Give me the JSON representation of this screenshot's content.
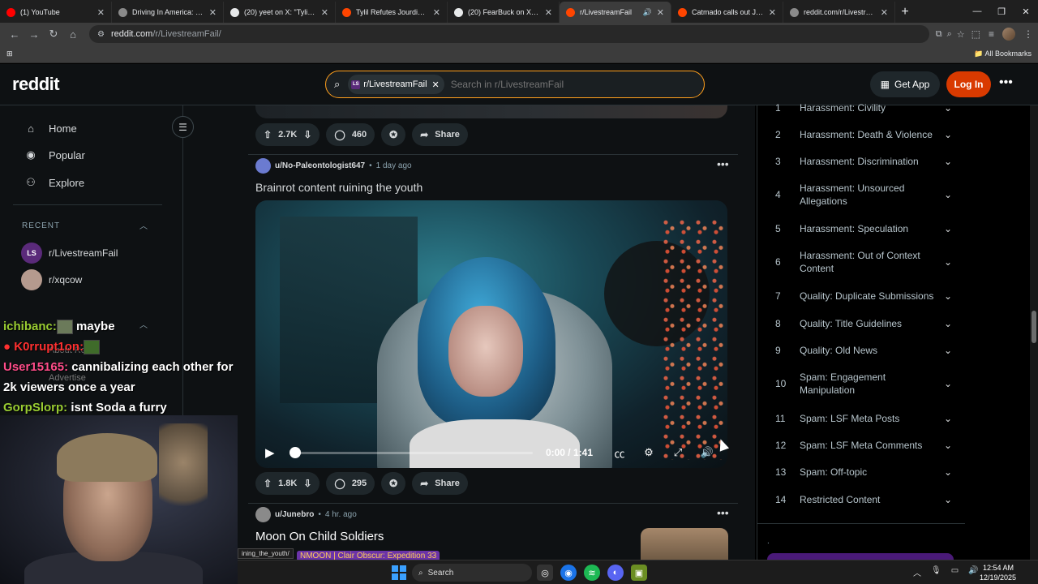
{
  "browser": {
    "tabs": [
      {
        "title": "(1) YouTube",
        "color": "#ff0000",
        "active": false
      },
      {
        "title": "Driving In America: Comm",
        "color": "#8a8a8a",
        "active": false
      },
      {
        "title": "(20) yeet on X: \"Tylil denie",
        "color": "#e7e9ea",
        "active": false
      },
      {
        "title": "Tylil Refutes Jourdin Pauli",
        "color": "#ff4500",
        "active": false
      },
      {
        "title": "(20) FearBuck on X: \"Tylil a",
        "color": "#e7e9ea",
        "active": false
      },
      {
        "title": "r/LivestreamFail",
        "color": "#ff4500",
        "active": true
      },
      {
        "title": "Catmado calls out JasonT",
        "color": "#ff4500",
        "active": false
      },
      {
        "title": "reddit.com/r/Livestreamf",
        "color": "#8a8a8a",
        "active": false
      }
    ],
    "url_host": "reddit.com",
    "url_path": "/r/LivestreamFail/",
    "bookmarks_label": "All Bookmarks"
  },
  "header": {
    "logo": "reddit",
    "search_chip": "r/LivestreamFail",
    "search_chip_badge": "LS",
    "search_placeholder": "Search in r/LivestreamFail",
    "get_app": "Get App",
    "login": "Log In"
  },
  "sidebar": {
    "items": [
      {
        "label": "Home",
        "icon": "home-icon"
      },
      {
        "label": "Popular",
        "icon": "popular-icon"
      },
      {
        "label": "Explore",
        "icon": "explore-icon"
      }
    ],
    "recent_heading": "RECENT",
    "recent": [
      {
        "label": "r/LivestreamFail",
        "badge": "LS"
      },
      {
        "label": "r/xqcow",
        "badge": ""
      }
    ],
    "ghost_about": "About Redd",
    "ghost_advertise": "Advertise"
  },
  "chat": [
    {
      "user": "ichibanc:",
      "text": "maybe"
    },
    {
      "user": "K0rrupt1on:",
      "text": ""
    },
    {
      "user": "User15165:",
      "text": "cannibalizing each other for 2k viewers once a year"
    },
    {
      "user": "GorpSlorp:",
      "text": "isnt Soda a furry"
    }
  ],
  "tooltip": "ining_the_youth/",
  "feed": {
    "prev_post": {
      "votes": "2.7K",
      "comments": "460",
      "share": "Share"
    },
    "post1": {
      "author": "u/No-Paleontologist647",
      "time": "1 day ago",
      "title": "Brainrot content ruining the youth",
      "video_time": "0:00 / 1:41",
      "progress": 0,
      "votes": "1.8K",
      "comments": "295",
      "share": "Share"
    },
    "post2": {
      "author": "u/Junebro",
      "time": "4 hr. ago",
      "title": "Moon On Child Soldiers",
      "flair": "NMOON | Clair Obscur: Expedition 33"
    }
  },
  "rules": [
    {
      "num": "1",
      "text": "Harassment: Civility"
    },
    {
      "num": "2",
      "text": "Harassment: Death & Violence"
    },
    {
      "num": "3",
      "text": "Harassment: Discrimination"
    },
    {
      "num": "4",
      "text": "Harassment: Unsourced Allegations"
    },
    {
      "num": "5",
      "text": "Harassment: Speculation"
    },
    {
      "num": "6",
      "text": "Harassment: Out of Context Content"
    },
    {
      "num": "7",
      "text": "Quality: Duplicate Submissions"
    },
    {
      "num": "8",
      "text": "Quality: Title Guidelines"
    },
    {
      "num": "9",
      "text": "Quality: Old News"
    },
    {
      "num": "10",
      "text": "Spam: Engagement Manipulation"
    },
    {
      "num": "11",
      "text": "Spam: LSF Meta Posts"
    },
    {
      "num": "12",
      "text": "Spam: LSF Meta Comments"
    },
    {
      "num": "13",
      "text": "Spam: Off-topic"
    },
    {
      "num": "14",
      "text": "Restricted Content"
    }
  ],
  "taskbar": {
    "search": "Search",
    "time": "12:54 AM",
    "date": "12/19/2025"
  },
  "colors": {
    "accent": "#d93a00",
    "search_border": "#ff9f1c"
  }
}
